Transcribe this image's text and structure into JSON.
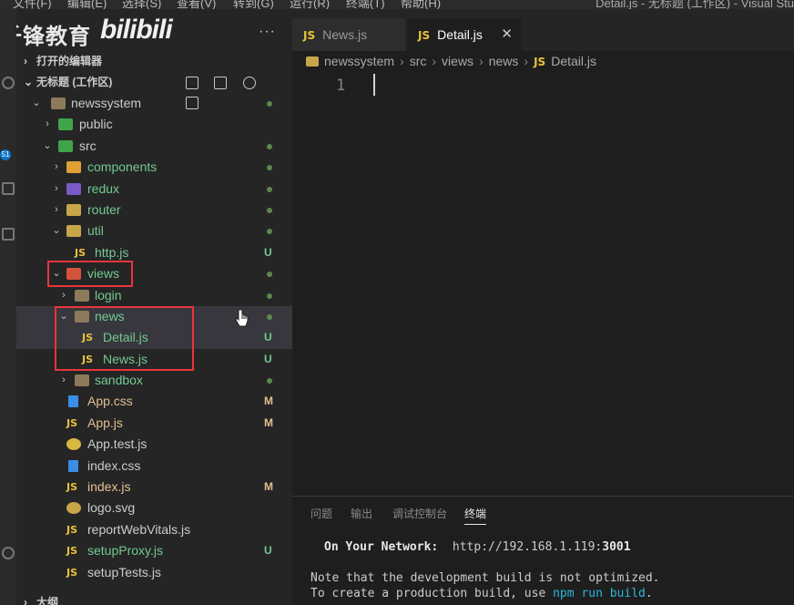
{
  "menu": {
    "items": [
      "文件(F)",
      "编辑(E)",
      "选择(S)",
      "查看(V)",
      "转到(G)",
      "运行(R)",
      "终端(T)",
      "帮助(H)"
    ],
    "window_title": "Detail.js - 无标题 (工作区) - Visual Stu"
  },
  "watermark": {
    "text": "千锋教育",
    "logo": "bilibili"
  },
  "sidebar": {
    "more": "···",
    "open_editors": "打开的编辑器",
    "workspace": "无标题 (工作区)",
    "tree": [
      {
        "name": "newssystem",
        "status": ""
      },
      {
        "name": "public",
        "status": ""
      },
      {
        "name": "src",
        "status": ""
      },
      {
        "name": "components",
        "status": ""
      },
      {
        "name": "redux",
        "status": ""
      },
      {
        "name": "router",
        "status": ""
      },
      {
        "name": "util",
        "status": ""
      },
      {
        "name": "http.js",
        "status": "U"
      },
      {
        "name": "views",
        "status": ""
      },
      {
        "name": "login",
        "status": ""
      },
      {
        "name": "news",
        "status": ""
      },
      {
        "name": "Detail.js",
        "status": "U"
      },
      {
        "name": "News.js",
        "status": "U"
      },
      {
        "name": "sandbox",
        "status": ""
      },
      {
        "name": "App.css",
        "status": "M"
      },
      {
        "name": "App.js",
        "status": "M"
      },
      {
        "name": "App.test.js",
        "status": ""
      },
      {
        "name": "index.css",
        "status": ""
      },
      {
        "name": "index.js",
        "status": "M"
      },
      {
        "name": "logo.svg",
        "status": ""
      },
      {
        "name": "reportWebVitals.js",
        "status": ""
      },
      {
        "name": "setupProxy.js",
        "status": "U"
      },
      {
        "name": "setupTests.js",
        "status": ""
      }
    ],
    "outline": "大纲"
  },
  "tabs": [
    {
      "icon": "JS",
      "label": "News.js"
    },
    {
      "icon": "JS",
      "label": "Detail.js",
      "close": "✕"
    }
  ],
  "breadcrumb": [
    "newssystem",
    "src",
    "views",
    "news",
    "Detail.js"
  ],
  "editor": {
    "line": "1"
  },
  "panel": {
    "tabs": [
      "问题",
      "输出",
      "调试控制台",
      "终端"
    ],
    "network_label": "On Your Network:",
    "network_url_prefix": "http://192.168.1.119:",
    "network_port": "3001",
    "note_line": "Note that the development build is not optimized.",
    "prod_prefix": "To create a production build, use ",
    "prod_cmd": "npm run build",
    "prod_suffix": "."
  },
  "colors": {
    "untracked": "#73c991",
    "modified": "#e2c08d",
    "js_icon": "#e8c33b",
    "highlight_box": "#e8353a"
  }
}
